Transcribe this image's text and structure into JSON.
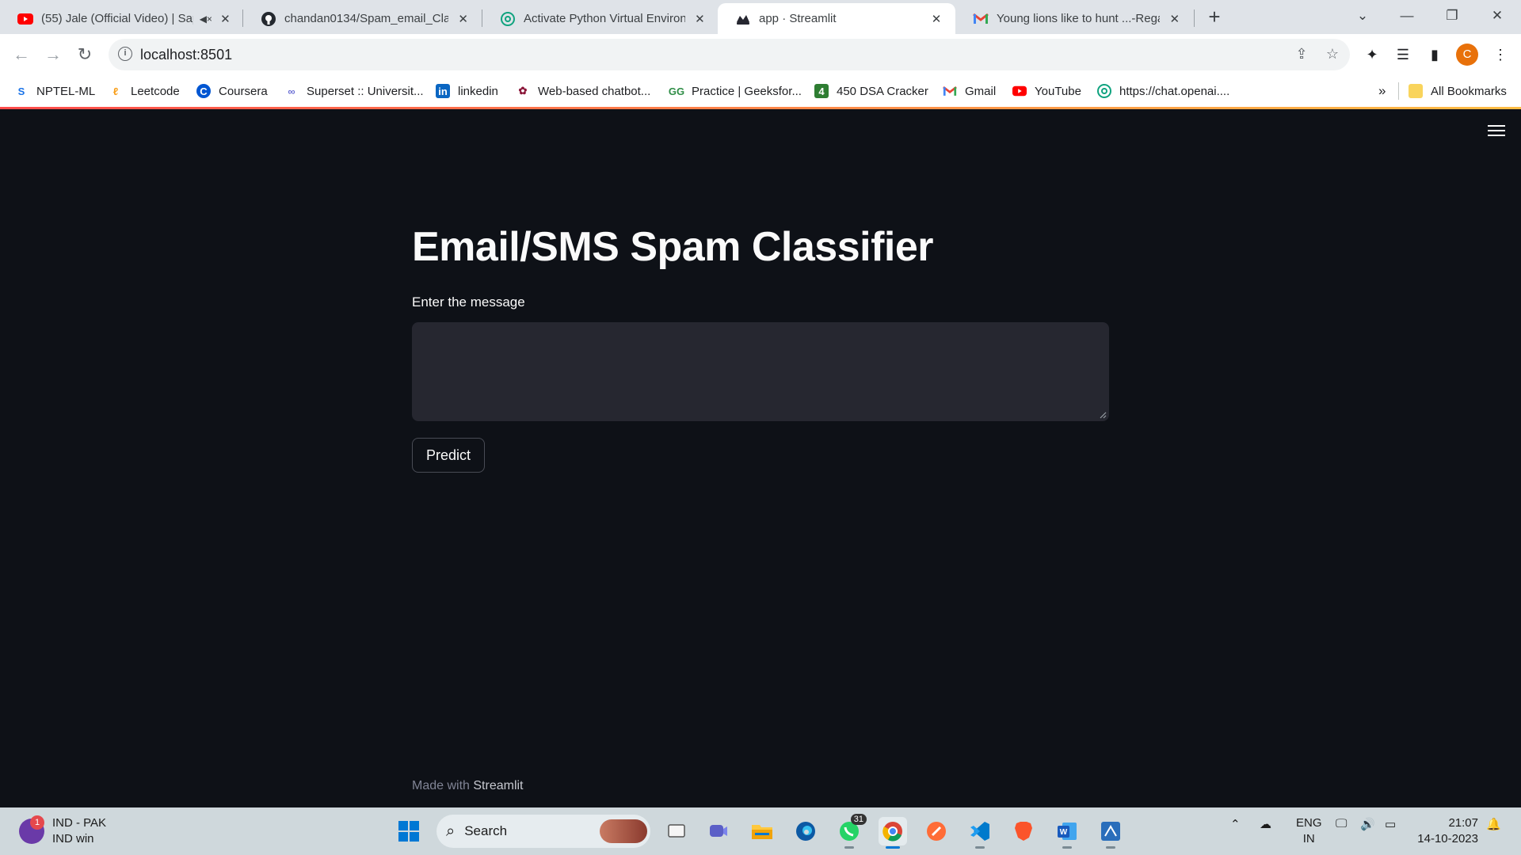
{
  "browser": {
    "tabs": [
      {
        "title": "(55) Jale (Official Video) | Sapna Choudhary",
        "icon": "youtube-icon",
        "muted": true,
        "active": false
      },
      {
        "title": "chandan0134/Spam_email_Classifier",
        "icon": "github-icon",
        "active": false
      },
      {
        "title": "Activate Python Virtual Environment",
        "icon": "chatgpt-icon",
        "active": false
      },
      {
        "title": "app · Streamlit",
        "icon": "streamlit-icon",
        "active": true
      },
      {
        "title": "Young lions like to hunt ...-Regard",
        "icon": "gmail-icon",
        "active": false
      }
    ],
    "url": "localhost:8501",
    "bookmarks": [
      {
        "label": "NPTEL-ML",
        "icon": "nptel-icon"
      },
      {
        "label": "Leetcode",
        "icon": "leetcode-icon"
      },
      {
        "label": "Coursera",
        "icon": "coursera-icon"
      },
      {
        "label": "Superset :: Universit...",
        "icon": "superset-icon"
      },
      {
        "label": "linkedin",
        "icon": "linkedin-icon"
      },
      {
        "label": "Web-based chatbot...",
        "icon": "chatbot-icon"
      },
      {
        "label": "Practice | Geeksfor...",
        "icon": "geeksforgeeks-icon"
      },
      {
        "label": "450 DSA Cracker",
        "icon": "dsa-cracker-icon"
      },
      {
        "label": "Gmail",
        "icon": "gmail-icon"
      },
      {
        "label": "YouTube",
        "icon": "youtube-icon"
      },
      {
        "label": "https://chat.openai....",
        "icon": "chatgpt-icon"
      }
    ],
    "more_bookmarks": "»",
    "all_bookmarks": "All Bookmarks",
    "profile_initial": "C"
  },
  "app": {
    "title": "Email/SMS Spam Classifier",
    "input_label": "Enter the message",
    "message_value": "",
    "predict_label": "Predict",
    "footer_prefix": "Made with ",
    "footer_brand": "Streamlit"
  },
  "taskbar": {
    "weather_badge": "1",
    "weather_line1": "IND - PAK",
    "weather_line2": "IND win",
    "search_label": "Search",
    "whatsapp_badge": "31",
    "lang_line1": "ENG",
    "lang_line2": "IN",
    "time": "21:07",
    "date": "14-10-2023"
  },
  "colors": {
    "page_bg": "#0e1117",
    "text": "#fafafa",
    "input_bg": "#262730",
    "decoration_start": "#ff4b4b",
    "decoration_end": "#ffbd45",
    "footer_text": "#808495"
  }
}
